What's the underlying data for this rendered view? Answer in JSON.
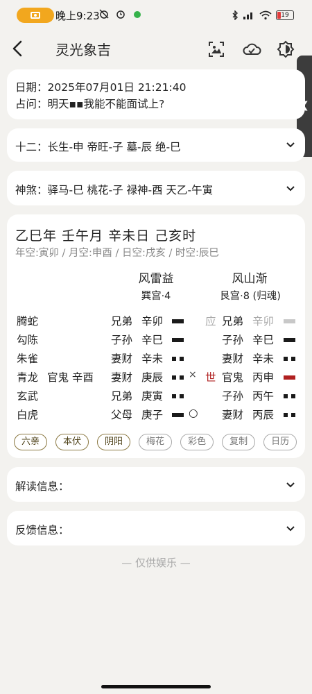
{
  "status_bar": {
    "time": "晚上9:23",
    "battery": "19"
  },
  "header": {
    "title": "灵光象吉"
  },
  "info": {
    "date": "日期：2025年07月01日 21:21:40",
    "question": "占问：明天▪▪我能不能面试上?"
  },
  "shier": {
    "label": "十二：长生-申 帝旺-子 墓-辰 绝-巳"
  },
  "shensha": {
    "label": "神煞：驿马-巳 桃花-子 禄神-酉 天乙-午寅"
  },
  "chart": {
    "ganzhi": "乙巳年 壬午月 辛未日 己亥时",
    "kongwang": "年空:寅卯 / 月空:申酉 / 日空:戌亥 / 时空:辰巳",
    "ben_gua": {
      "name": "风雷益",
      "gong": "巽宫·4"
    },
    "bian_gua": {
      "name": "风山渐",
      "gong": "艮宫·8 (归魂)"
    },
    "rows": [
      {
        "god": "腾蛇",
        "fu": "",
        "liuqin": "兄弟",
        "ganzhi": "辛卯",
        "yao": "yang",
        "mark": "",
        "shi": "应",
        "b_liuqin": "兄弟",
        "b_ganzhi": "辛卯",
        "b_yao": "yang",
        "b_style": "gray"
      },
      {
        "god": "勾陈",
        "fu": "",
        "liuqin": "子孙",
        "ganzhi": "辛巳",
        "yao": "yang",
        "mark": "",
        "shi": "",
        "b_liuqin": "子孙",
        "b_ganzhi": "辛巳",
        "b_yao": "yang",
        "b_style": ""
      },
      {
        "god": "朱雀",
        "fu": "",
        "liuqin": "妻财",
        "ganzhi": "辛未",
        "yao": "yin",
        "mark": "",
        "shi": "",
        "b_liuqin": "妻财",
        "b_ganzhi": "辛未",
        "b_yao": "yin",
        "b_style": ""
      },
      {
        "god": "青龙",
        "fu": "官鬼 辛酉",
        "liuqin": "妻财",
        "ganzhi": "庚辰",
        "yao": "yin",
        "mark": "×",
        "shi": "世",
        "b_liuqin": "官鬼",
        "b_ganzhi": "丙申",
        "b_yao": "yang",
        "b_style": "red"
      },
      {
        "god": "玄武",
        "fu": "",
        "liuqin": "兄弟",
        "ganzhi": "庚寅",
        "yao": "yin",
        "mark": "",
        "shi": "",
        "b_liuqin": "子孙",
        "b_ganzhi": "丙午",
        "b_yao": "yin",
        "b_style": ""
      },
      {
        "god": "白虎",
        "fu": "",
        "liuqin": "父母",
        "ganzhi": "庚子",
        "yao": "yang",
        "mark": "○",
        "shi": "",
        "b_liuqin": "妻财",
        "b_ganzhi": "丙辰",
        "b_yao": "yin",
        "b_style": ""
      }
    ],
    "tags": [
      {
        "label": "六亲",
        "on": true
      },
      {
        "label": "本伏",
        "on": true
      },
      {
        "label": "阴阳",
        "on": true
      },
      {
        "label": "梅花",
        "on": false
      },
      {
        "label": "彩色",
        "on": false
      },
      {
        "label": "复制",
        "on": false
      },
      {
        "label": "日历",
        "on": false
      }
    ]
  },
  "jiedu": {
    "label": "解读信息："
  },
  "fankui": {
    "label": "反馈信息："
  },
  "footnote": "— 仅供娱乐 —",
  "colors": {
    "accent_red": "#b02020",
    "pill_orange": "#f2a71e"
  }
}
